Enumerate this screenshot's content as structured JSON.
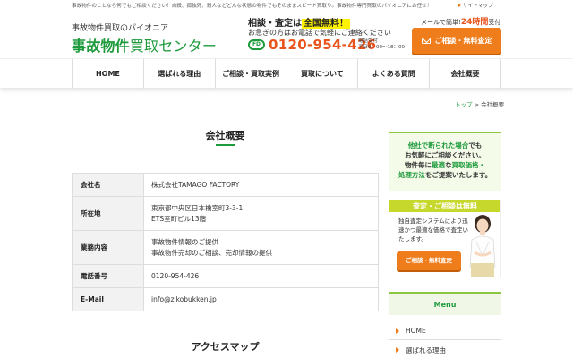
{
  "topbar": {
    "message": "事故物件のことなら何でもご相談ください！自殺、孤独死、殺人などどんな状態の物件でもそのままスピード買取り。事故物件専門買取のパイオニアにお任せ！",
    "sitemap": "サイトマップ"
  },
  "logo": {
    "sub": "事故物件買取のパイオニア",
    "main_bold": "事故物件",
    "main_thin": "買取センター"
  },
  "header": {
    "consult_prefix": "相談・査定は",
    "consult_free": "全国無料！",
    "consult_sub": "お急ぎの方はお電話で気軽にご連絡ください",
    "freedial_label": "FD",
    "phone": "0120-954-426",
    "hours_1": "電話受付",
    "hours_2": "平日9：00〜18：00",
    "mail_note_prefix": "メールで簡単!",
    "mail_note_highlight": "24時間",
    "mail_note_suffix": "受付",
    "mail_button": "ご相談・無料査定"
  },
  "nav": {
    "items": [
      "HOME",
      "選ばれる理由",
      "ご相談・買取実例",
      "買取について",
      "よくある質問",
      "会社概要"
    ]
  },
  "breadcrumb": {
    "top": "トップ",
    "separator": ">",
    "current": "会社概要"
  },
  "main": {
    "title": "会社概要",
    "table": [
      {
        "key": "会社名",
        "lines": [
          "株式会社TAMAGO FACTORY"
        ]
      },
      {
        "key": "所在地",
        "lines": [
          "東京都中央区日本橋室町3-3-1",
          "ETS室町ビル13階"
        ]
      },
      {
        "key": "業務内容",
        "lines": [
          "事故物件情報のご提供",
          "事故物件売却のご相談、売却情報の提供"
        ]
      },
      {
        "key": "電話番号",
        "lines": [
          "0120-954-426"
        ]
      },
      {
        "key": "E-Mail",
        "lines": [
          "info@zikobukken.jp"
        ]
      }
    ],
    "access_title": "アクセスマップ"
  },
  "sidebar": {
    "banner1": {
      "line1_green": "他社で断られた場合",
      "line1_rest": "でも",
      "line2": "お気軽にご相談ください。",
      "line3_pre": "物件毎に",
      "line3_green": "最適",
      "line3_mid": "な",
      "line3_green2": "買取価格・",
      "line4_green": "処理方法",
      "line4_rest": "をご提案いたします。"
    },
    "banner2": {
      "header": "査定・ご相談は無料",
      "text": "独自査定システムにより迅速かつ最適な価格で査定いたします。",
      "button": "ご相談・無料査定"
    },
    "menu": {
      "title": "Menu",
      "items": [
        "HOME",
        "選ばれる理由"
      ]
    }
  },
  "colors": {
    "brand_green": "#1d9a3c",
    "accent_orange": "#ef7d1b",
    "phone_orange": "#e8541c",
    "lime": "#c6d82c"
  }
}
